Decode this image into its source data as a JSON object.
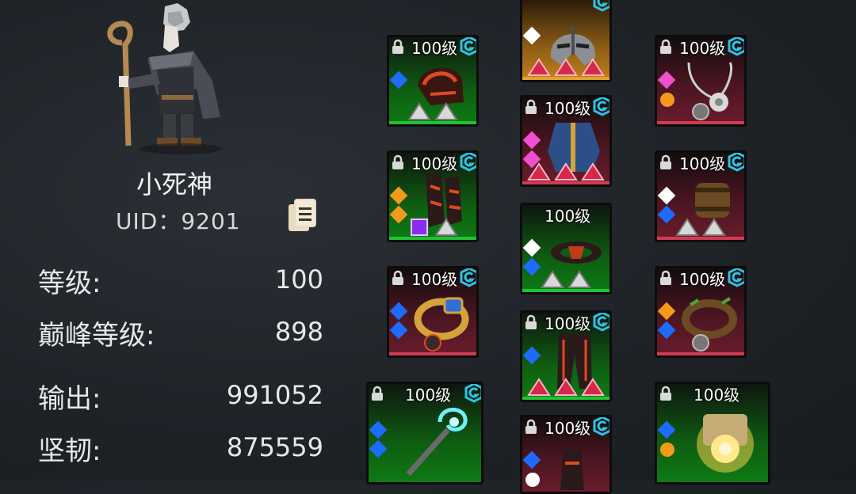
{
  "profile": {
    "name": "小死神",
    "uid": "UID：9201",
    "stats": [
      {
        "label": "等级:",
        "value": "100"
      },
      {
        "label": "巅峰等级:",
        "value": "898"
      },
      {
        "label": "输出:",
        "value": "991052"
      },
      {
        "label": "坚韧:",
        "value": "875559"
      }
    ]
  },
  "equipment": [
    {
      "level": "100级",
      "item": "shoulder-armor-icon"
    },
    {
      "level": "",
      "item": "helmet-icon"
    },
    {
      "level": "100级",
      "item": "amulet-icon"
    },
    {
      "level": "100级",
      "item": "chest-armor-icon"
    },
    {
      "level": "100级",
      "item": "gloves-icon"
    },
    {
      "level": "100级",
      "item": "bracer-icon"
    },
    {
      "level": "100级",
      "item": "belt-icon"
    },
    {
      "level": "100级",
      "item": "ring-icon"
    },
    {
      "level": "100级",
      "item": "pants-icon"
    },
    {
      "level": "100级",
      "item": "ring-icon"
    },
    {
      "level": "100级",
      "item": "staff-icon"
    },
    {
      "level": "100级",
      "item": "boots-icon"
    },
    {
      "level": "100级",
      "item": "scroll-icon"
    }
  ],
  "colors": {
    "green": "#0d7a14",
    "red": "#6a1c2c",
    "orange": "#c27f1c",
    "blue_gem": "#1e6bff",
    "orange_gem": "#f39a1a",
    "pink_gem": "#f04fd0",
    "white_gem": "#ffffff",
    "g_icon": "#29c4e6"
  }
}
